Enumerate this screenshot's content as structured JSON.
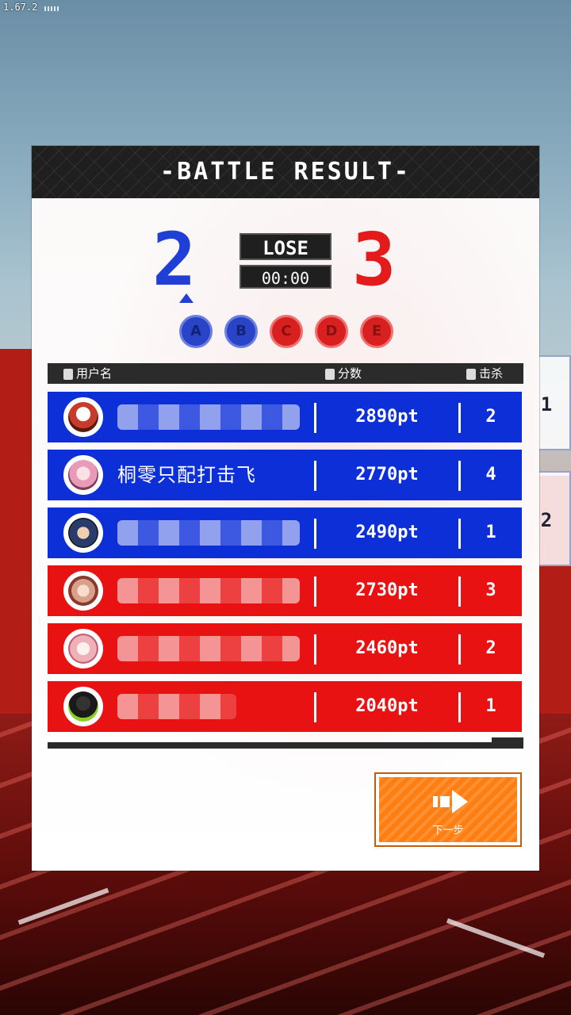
{
  "status": {
    "version": "1.67.2"
  },
  "header": {
    "title": "-BATTLE RESULT-"
  },
  "match": {
    "left_score": "2",
    "right_score": "3",
    "result": "LOSE",
    "time": "00:00",
    "points": [
      {
        "letter": "A",
        "team": "blue"
      },
      {
        "letter": "B",
        "team": "blue"
      },
      {
        "letter": "C",
        "team": "red"
      },
      {
        "letter": "D",
        "team": "red"
      },
      {
        "letter": "E",
        "team": "red"
      }
    ],
    "colors": {
      "blue": "#0d2fd8",
      "red": "#e81212"
    }
  },
  "table": {
    "col_username": "用户名",
    "col_score": "分数",
    "col_kills": "击杀",
    "rows": [
      {
        "name": "",
        "score": "2890pt",
        "kills": "2",
        "team": "blue",
        "avatar_color": "#c83a2a"
      },
      {
        "name": "桐零只配打击飞",
        "score": "2770pt",
        "kills": "4",
        "team": "blue",
        "avatar_color": "#e89ab8"
      },
      {
        "name": "",
        "score": "2490pt",
        "kills": "1",
        "team": "blue",
        "avatar_color": "#2a3a6a"
      },
      {
        "name": "",
        "score": "2730pt",
        "kills": "3",
        "team": "red",
        "avatar_color": "#d8a08a"
      },
      {
        "name": "",
        "score": "2460pt",
        "kills": "2",
        "team": "red",
        "avatar_color": "#f0b0b8"
      },
      {
        "name": "",
        "score": "2040pt",
        "kills": "1",
        "team": "red",
        "avatar_color": "#1a1a1a"
      }
    ]
  },
  "next_button": {
    "label": "下一步",
    "icon": "arrow-right-icon"
  },
  "side_tabs": [
    {
      "label": "1"
    },
    {
      "label": "2"
    }
  ]
}
